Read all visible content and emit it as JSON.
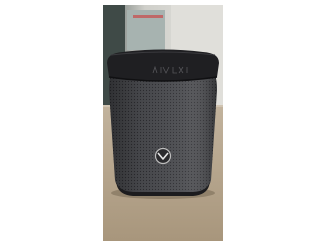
{
  "photo": {
    "subject_icon": "speaker-icon",
    "colors": {
      "background_left": "#ffffff",
      "background_right": "#ffffff",
      "wall": "#d6d5d0",
      "table": "#b9a88f",
      "speaker_body": "#4a4b4f",
      "speaker_top": "#1f1f22",
      "logo_badge": "#2b2b2e"
    }
  }
}
